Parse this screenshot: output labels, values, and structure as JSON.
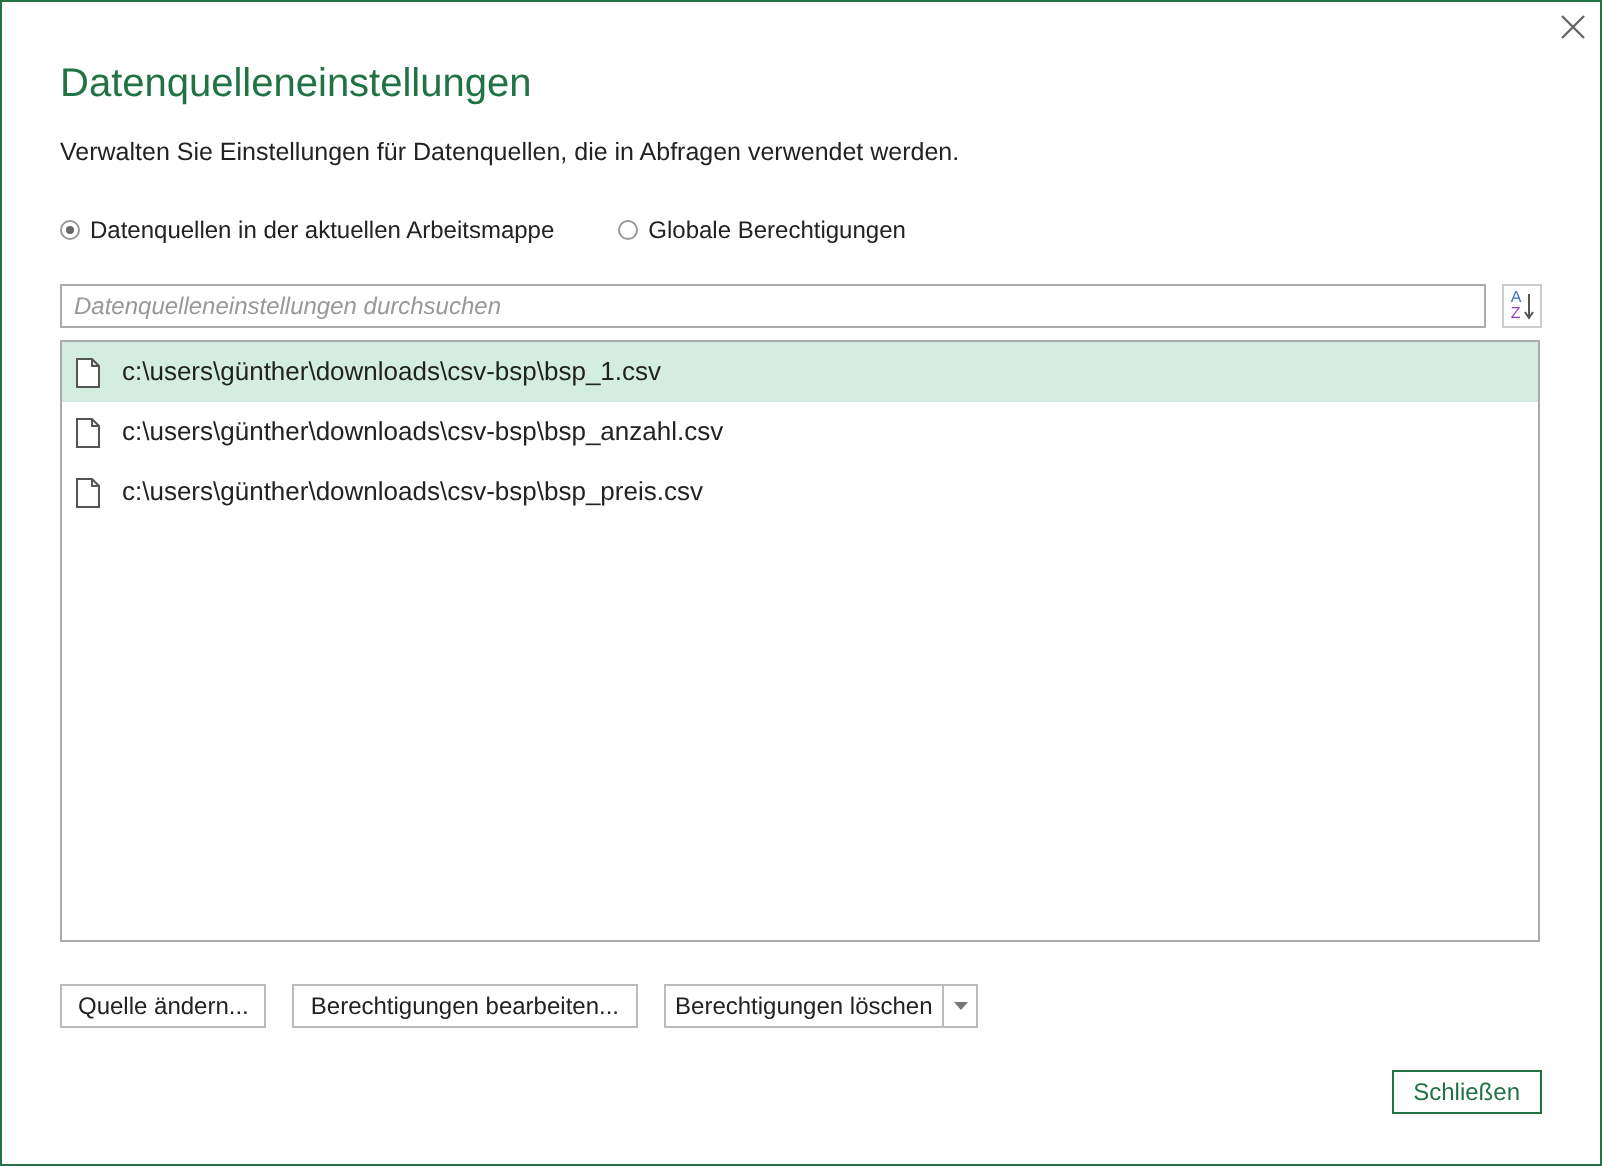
{
  "window": {
    "title": "Datenquelleneinstellungen",
    "description": "Verwalten Sie Einstellungen für Datenquellen, die in Abfragen verwendet werden."
  },
  "scope_options": [
    {
      "label": "Datenquellen in der aktuellen Arbeitsmappe",
      "selected": true
    },
    {
      "label": "Globale Berechtigungen",
      "selected": false
    }
  ],
  "search": {
    "placeholder": "Datenquelleneinstellungen durchsuchen"
  },
  "sort_button": {
    "top_letter": "A",
    "bottom_letter": "Z"
  },
  "sources": [
    {
      "path": "c:\\users\\günther\\downloads\\csv-bsp\\bsp_1.csv",
      "selected": true
    },
    {
      "path": "c:\\users\\günther\\downloads\\csv-bsp\\bsp_anzahl.csv",
      "selected": false
    },
    {
      "path": "c:\\users\\günther\\downloads\\csv-bsp\\bsp_preis.csv",
      "selected": false
    }
  ],
  "actions": [
    {
      "label": "Quelle ändern...",
      "kind": "plain"
    },
    {
      "label": "Berechtigungen bearbeiten...",
      "kind": "plain"
    },
    {
      "label": "Berechtigungen löschen",
      "kind": "split"
    }
  ],
  "close_button": "Schließen"
}
